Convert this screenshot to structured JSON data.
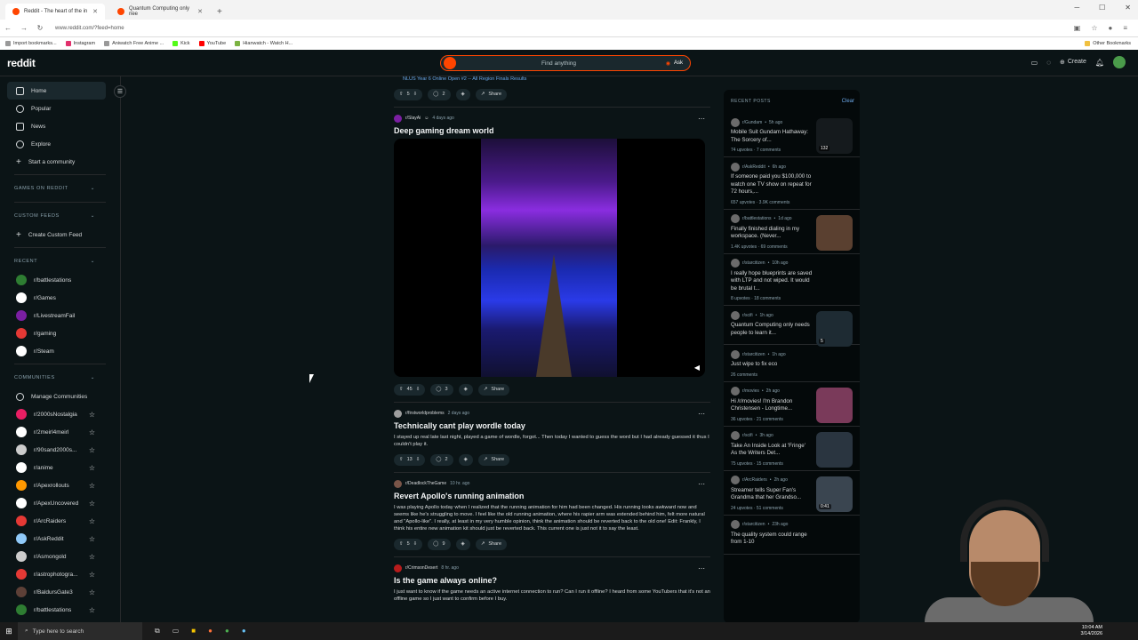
{
  "browser": {
    "tabs": [
      {
        "label": "Reddit - The heart of the in"
      },
      {
        "label": "Quantum Computing only nee"
      }
    ],
    "url": "www.reddit.com/?feed=home",
    "bookmarks": [
      "Import bookmarks...",
      "Instagram",
      "Aniwatch Free Anime ...",
      "Kick",
      "YouTube",
      "Hianwatch - Watch H..."
    ],
    "other_bookmarks": "Other Bookmarks"
  },
  "header": {
    "logo": "reddit",
    "search_placeholder": "Find anything",
    "ask_label": "Ask",
    "create_label": "Create"
  },
  "sidebar": {
    "nav": [
      {
        "label": "Home"
      },
      {
        "label": "Popular"
      },
      {
        "label": "News"
      },
      {
        "label": "Explore"
      },
      {
        "label": "Start a community"
      }
    ],
    "games_section": "GAMES ON REDDIT",
    "custom_feeds_section": "CUSTOM FEEDS",
    "create_custom_feed": "Create Custom Feed",
    "recent_section": "RECENT",
    "recent": [
      {
        "label": "r/battlestations",
        "color": "#2e7d32"
      },
      {
        "label": "r/Games",
        "color": "#ffffff"
      },
      {
        "label": "r/LivestreamFail",
        "color": "#7b1fa2"
      },
      {
        "label": "r/gaming",
        "color": "#e53935"
      },
      {
        "label": "r/Steam",
        "color": "#ffffff"
      }
    ],
    "communities_section": "COMMUNITIES",
    "manage_communities": "Manage Communities",
    "communities": [
      {
        "label": "r/2000sNostalgia",
        "color": "#e91e63"
      },
      {
        "label": "r/2meirl4meirl",
        "color": "#ffffff"
      },
      {
        "label": "r/90sand2000s...",
        "color": "#cccccc"
      },
      {
        "label": "r/anime",
        "color": "#ffffff"
      },
      {
        "label": "r/Apexrollouts",
        "color": "#ff9800"
      },
      {
        "label": "r/ApexUncovered",
        "color": "#ffffff"
      },
      {
        "label": "r/ArcRaiders",
        "color": "#e53935"
      },
      {
        "label": "r/AskReddit",
        "color": "#90caf9"
      },
      {
        "label": "r/Asmongold",
        "color": "#cccccc"
      },
      {
        "label": "r/astrophotogra...",
        "color": "#e53935"
      },
      {
        "label": "r/BaldursGate3",
        "color": "#5d4037"
      },
      {
        "label": "r/battlestations",
        "color": "#2e7d32"
      }
    ]
  },
  "feed": {
    "top_link": "NLUS Year 6 Online Open #2 -- All Region Finals Results",
    "posts": [
      {
        "votes": "5",
        "comments": "2",
        "share": "Share"
      },
      {
        "subreddit": "r/SlayAi",
        "time": "4 days ago",
        "title": "Deep gaming dream world",
        "votes": "45",
        "comments": "3",
        "share": "Share"
      },
      {
        "subreddit": "r/firstworldproblems",
        "time": "2 days ago",
        "title": "Technically cant play wordle today",
        "body": "I stayed up real late last night, played a game of wordle, forgot... Then today I wanted to guess the word but I had already guessed it thus I couldn't play it.",
        "votes": "13",
        "comments": "2",
        "share": "Share"
      },
      {
        "subreddit": "r/DeadlockTheGame",
        "time": "10 hr. ago",
        "title": "Revert Apollo's running animation",
        "body": "I was playing Apollo today when I realized that the running animation for him had been changed. His running looks awkward now and seems like he's struggling to move. I feel like the old running animation, where his rapier arm was extended behind him, felt more natural and \"Apollo-like\". I really, at least in my very humble opinion, think the animation should be reverted back to the old one! Edit: Frankly, I think his entire new animation kit should just be reverted back. This current one is just not it to say the least.",
        "votes": "5",
        "comments": "9",
        "share": "Share"
      },
      {
        "subreddit": "r/CrimsonDesert",
        "time": "8 hr. ago",
        "title": "Is the game always online?",
        "body": "I just want to know if the game needs an active internet connection to run? Can I run it offline? I heard from some YouTubers that it's not an offline game so I just want to confirm before I buy."
      }
    ]
  },
  "recent_posts": {
    "heading": "RECENT POSTS",
    "clear": "Clear",
    "items": [
      {
        "sub": "r/Gundam",
        "time": "5h ago",
        "title": "Mobile Suit Gundam Hathaway: The Sorcery of...",
        "stats": "74 upvotes · 7 comments",
        "thumb": "#151a1d",
        "badge": "132"
      },
      {
        "sub": "r/AskReddit",
        "time": "6h ago",
        "title": "If someone paid you $100,000 to watch one TV show on repeat for 72 hours,...",
        "stats": "657 upvotes · 3.9K comments"
      },
      {
        "sub": "r/battlestations",
        "time": "1d ago",
        "title": "Finally finished dialing in my workspace. (Never...",
        "stats": "1.4K upvotes · 69 comments",
        "thumb": "#5a4030"
      },
      {
        "sub": "r/starcitizen",
        "time": "10h ago",
        "title": "I really hope blueprints are saved with LTP and not wiped. It would be brutal t...",
        "stats": "8 upvotes · 18 comments"
      },
      {
        "sub": "r/scifi",
        "time": "1h ago",
        "title": "Quantum Computing only needs people to learn it...",
        "stats": "",
        "thumb": "#1e2b33",
        "badge": "5"
      },
      {
        "sub": "r/starcitizen",
        "time": "1h ago",
        "title": "Just wipe to fix eco",
        "stats": "26 comments"
      },
      {
        "sub": "r/movies",
        "time": "2h ago",
        "title": "Hi /r/movies! I'm Brandon Christensen - Longtime...",
        "stats": "36 upvotes · 21 comments",
        "thumb": "#7a3a5a"
      },
      {
        "sub": "r/scifi",
        "time": "3h ago",
        "title": "Take An Inside Look at 'Fringe' As the Writers Det...",
        "stats": "75 upvotes · 15 comments",
        "thumb": "#2a3540"
      },
      {
        "sub": "r/ArcRaiders",
        "time": "2h ago",
        "title": "Streamer tells Super Fan's Grandma that her Grandso...",
        "stats": "24 upvotes · 51 comments",
        "thumb": "#3a4550",
        "badge": "0:41"
      },
      {
        "sub": "r/starcitizen",
        "time": "23h ago",
        "title": "The quality system could range from 1-10",
        "stats": ""
      }
    ]
  },
  "taskbar": {
    "search_placeholder": "Type here to search",
    "time": "10:04 AM",
    "date": "3/14/2026"
  }
}
